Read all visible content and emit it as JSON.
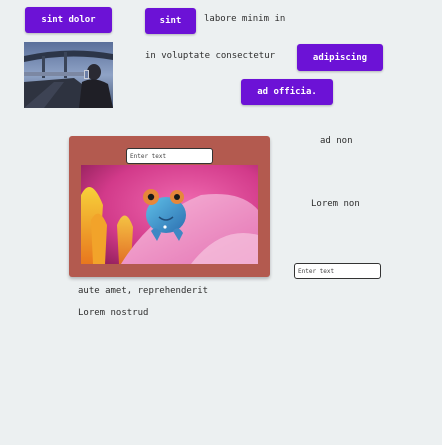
{
  "buttons": {
    "top_left": "sint dolor",
    "top_mid": "sint",
    "adipiscing": "adipiscing",
    "ad_officia": "ad officia."
  },
  "texts": {
    "labore": "labore minim in",
    "voluptate": "in voluptate consectetur",
    "ad_non": "ad non",
    "lorem_non": "Lorem non",
    "aute": "aute amet, reprehenderit",
    "lorem_nostrud": "Lorem nostrud"
  },
  "inputs": {
    "panel_placeholder": "Enter text",
    "right_placeholder": "Enter text"
  },
  "colors": {
    "background": "#ecf0f1",
    "button": "#6c12d6",
    "panel": "#b35a4f"
  },
  "images": {
    "photo_icon": "road-photo-icon",
    "chameleon_icon": "chameleon-photo-icon"
  }
}
